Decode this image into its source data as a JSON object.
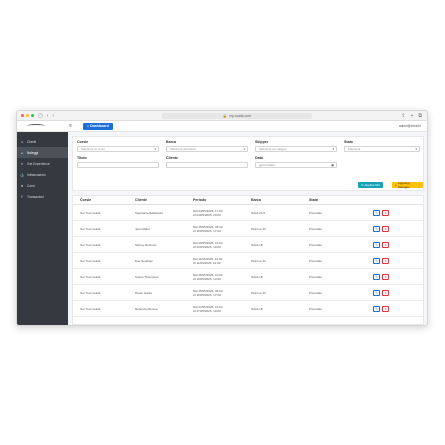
{
  "browser": {
    "url": "my-roads.com",
    "nav_icons": [
      "sidebar-icon",
      "back-icon",
      "forward-icon"
    ],
    "right_icons": [
      "share-icon",
      "new-tab-icon",
      "tabs-icon"
    ]
  },
  "topbar": {
    "dashboard_label": "Dashboard",
    "user_email": "admin@email.it"
  },
  "sidebar": {
    "items": [
      {
        "label": "Clienti",
        "icon": "users-icon",
        "active": false
      },
      {
        "label": "Noleggi",
        "icon": "boat-icon",
        "active": true
      },
      {
        "label": "Get Experience",
        "icon": "star-icon",
        "active": false
      },
      {
        "label": "Imbarcazioni",
        "icon": "anchor-icon",
        "active": false
      },
      {
        "label": "Corsi",
        "icon": "book-icon",
        "active": false
      },
      {
        "label": "Transazioni",
        "icon": "euro-icon",
        "active": false
      }
    ]
  },
  "filters": {
    "corsie_label": "Corsie",
    "corsie_value": "Seleziona un corso",
    "barca_label": "Barca",
    "barca_value": "Seleziona una barca",
    "skipper_label": "Skipper",
    "skipper_value": "Seleziona uno skipper",
    "stato_label": "Stato",
    "stato_value": "Seleziona",
    "titolo_label": "Titolo",
    "titolo_value": "",
    "cliente_label": "Cliente",
    "cliente_value": "",
    "data_label": "Data",
    "data_value": "gg/mm/aaaa",
    "apply_label": "Applica filtri",
    "add_label": "Aggiungi Noleggio"
  },
  "table": {
    "headers": [
      "Corsie",
      "Cliente",
      "Periodo",
      "Barca",
      "Stato"
    ],
    "rows": [
      {
        "corso": "Get Your Guide",
        "cliente": "Stephanie Baldassini",
        "periodo1": "Dal 04/05/2025, 17:00",
        "periodo2": "Al 04/05/2025, 20:00",
        "barca": "Soleil 24.5",
        "stato": "Prenotato"
      },
      {
        "corso": "Get Your Guide",
        "cliente": "Jean Marot",
        "periodo1": "Dal 15/05/2025, 09:30",
        "periodo2": "Al 15/05/2025, 17:00",
        "barca": "Patrone 23",
        "stato": "Prenotato"
      },
      {
        "corso": "Get Your Guide",
        "cliente": "Sidney Rehman",
        "periodo1": "Dal 20/05/2025, 16:00",
        "periodo2": "Al 20/05/2025, 19:00",
        "barca": "Soleil 18",
        "stato": "Prenotato"
      },
      {
        "corso": "Get Your Guide",
        "cliente": "Ene Southam",
        "periodo1": "Dal 11/06/2025, 10:00",
        "periodo2": "Al 11/06/2025, 14:00",
        "barca": "Patrone 22",
        "stato": "Prenotato"
      },
      {
        "corso": "Get Your Guide",
        "cliente": "Susan Thompson",
        "periodo1": "Dal 16/05/2025, 10:00",
        "periodo2": "Al 16/05/2025, 13:00",
        "barca": "Soleil 18",
        "stato": "Prenotato"
      },
      {
        "corso": "Get Your Guide",
        "cliente": "Daren Gates",
        "periodo1": "Dal 15/05/2025, 09:00",
        "periodo2": "Al 15/05/2025, 17:00",
        "barca": "Patrone 23",
        "stato": "Prenotato"
      },
      {
        "corso": "Get Your Guide",
        "cliente": "Rebecca Monroe",
        "periodo1": "Dal 27/05/2025, 16:00",
        "periodo2": "Al 27/05/2025, 19:00",
        "barca": "Soleil 18",
        "stato": "Prenotato"
      }
    ]
  },
  "colors": {
    "primary": "#1d6fd6",
    "info": "#17a2b8",
    "warning": "#ffc107",
    "danger": "#dc3545",
    "sidebar": "#343a40"
  }
}
